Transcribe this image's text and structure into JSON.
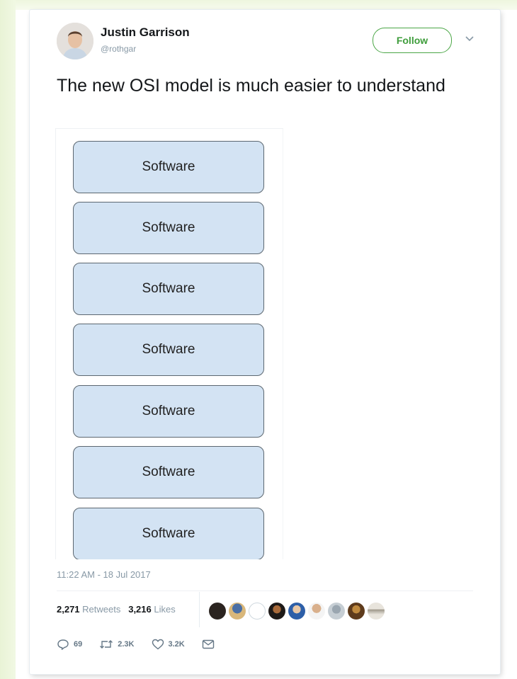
{
  "tweet": {
    "author": {
      "name": "Justin Garrison",
      "handle": "@rothgar"
    },
    "follow_label": "Follow",
    "text": "The new OSI model is much easier to understand",
    "image": {
      "layers": [
        "Software",
        "Software",
        "Software",
        "Software",
        "Software",
        "Software",
        "Software"
      ]
    },
    "timestamp": "11:22 AM - 18 Jul 2017",
    "stats": {
      "retweets_count": "2,271",
      "retweets_label": "Retweets",
      "likes_count": "3,216",
      "likes_label": "Likes"
    },
    "actions": {
      "replies": "69",
      "retweets": "2.3K",
      "likes": "3.2K"
    }
  },
  "colors": {
    "follow_green": "#3f9d3c",
    "layer_fill": "#d3e3f3",
    "muted_text": "#8899a6"
  },
  "icons": [
    "chevron-down-icon",
    "reply-icon",
    "retweet-icon",
    "heart-icon",
    "message-icon"
  ]
}
